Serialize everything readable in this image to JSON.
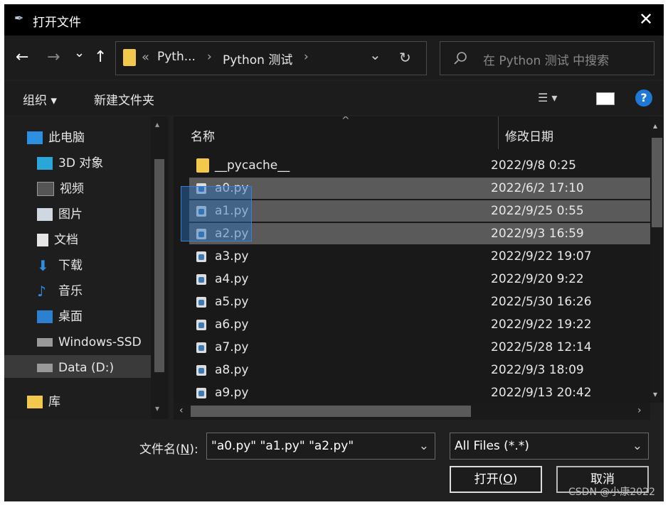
{
  "title": "打开文件",
  "nav": {
    "back": "←",
    "forward": "→",
    "recent": "⌄",
    "up": "↑"
  },
  "address": {
    "prefix": "«",
    "crumbs": [
      "Pyth...",
      "Python 测试"
    ],
    "sep": "›",
    "dropdown": "⌄",
    "refresh": "↻"
  },
  "search": {
    "placeholder": "在 Python 测试 中搜索"
  },
  "toolbar": {
    "organize": "组织 ▾",
    "new_folder": "新建文件夹",
    "help": "?"
  },
  "sidebar": {
    "items": [
      {
        "label": "此电脑",
        "icon": "computer-icon"
      },
      {
        "label": "3D 对象",
        "icon": "cube-icon"
      },
      {
        "label": "视频",
        "icon": "video-icon"
      },
      {
        "label": "图片",
        "icon": "picture-icon"
      },
      {
        "label": "文档",
        "icon": "document-icon"
      },
      {
        "label": "下载",
        "icon": "download-icon"
      },
      {
        "label": "音乐",
        "icon": "music-icon"
      },
      {
        "label": "桌面",
        "icon": "desktop-icon"
      },
      {
        "label": "Windows-SSD",
        "icon": "drive-icon"
      },
      {
        "label": "Data (D:)",
        "icon": "drive-icon"
      },
      {
        "label": "库",
        "icon": "library-icon"
      }
    ]
  },
  "columns": {
    "name": "名称",
    "date": "修改日期"
  },
  "files": [
    {
      "name": "__pycache__",
      "date": "2022/9/8 0:25",
      "type": "folder"
    },
    {
      "name": "a0.py",
      "date": "2022/6/2 17:10",
      "type": "py",
      "selected": true
    },
    {
      "name": "a1.py",
      "date": "2022/9/25 0:55",
      "type": "py",
      "selected": true
    },
    {
      "name": "a2.py",
      "date": "2022/9/3 16:59",
      "type": "py",
      "selected": true
    },
    {
      "name": "a3.py",
      "date": "2022/9/22 19:07",
      "type": "py"
    },
    {
      "name": "a4.py",
      "date": "2022/9/20 9:22",
      "type": "py"
    },
    {
      "name": "a5.py",
      "date": "2022/5/30 16:26",
      "type": "py"
    },
    {
      "name": "a6.py",
      "date": "2022/9/22 19:22",
      "type": "py"
    },
    {
      "name": "a7.py",
      "date": "2022/5/28 12:14",
      "type": "py"
    },
    {
      "name": "a8.py",
      "date": "2022/9/3 18:09",
      "type": "py"
    },
    {
      "name": "a9.py",
      "date": "2022/9/13 20:42",
      "type": "py"
    }
  ],
  "filename": {
    "label": "文件名(",
    "label_key": "N",
    "label_end": "):",
    "value": "\"a0.py\" \"a1.py\" \"a2.py\""
  },
  "filetype": {
    "value": "All Files (*.*)"
  },
  "buttons": {
    "open": "打开(",
    "open_key": "O",
    "open_end": ")",
    "cancel": "取消"
  },
  "watermark": "CSDN @小康2022"
}
